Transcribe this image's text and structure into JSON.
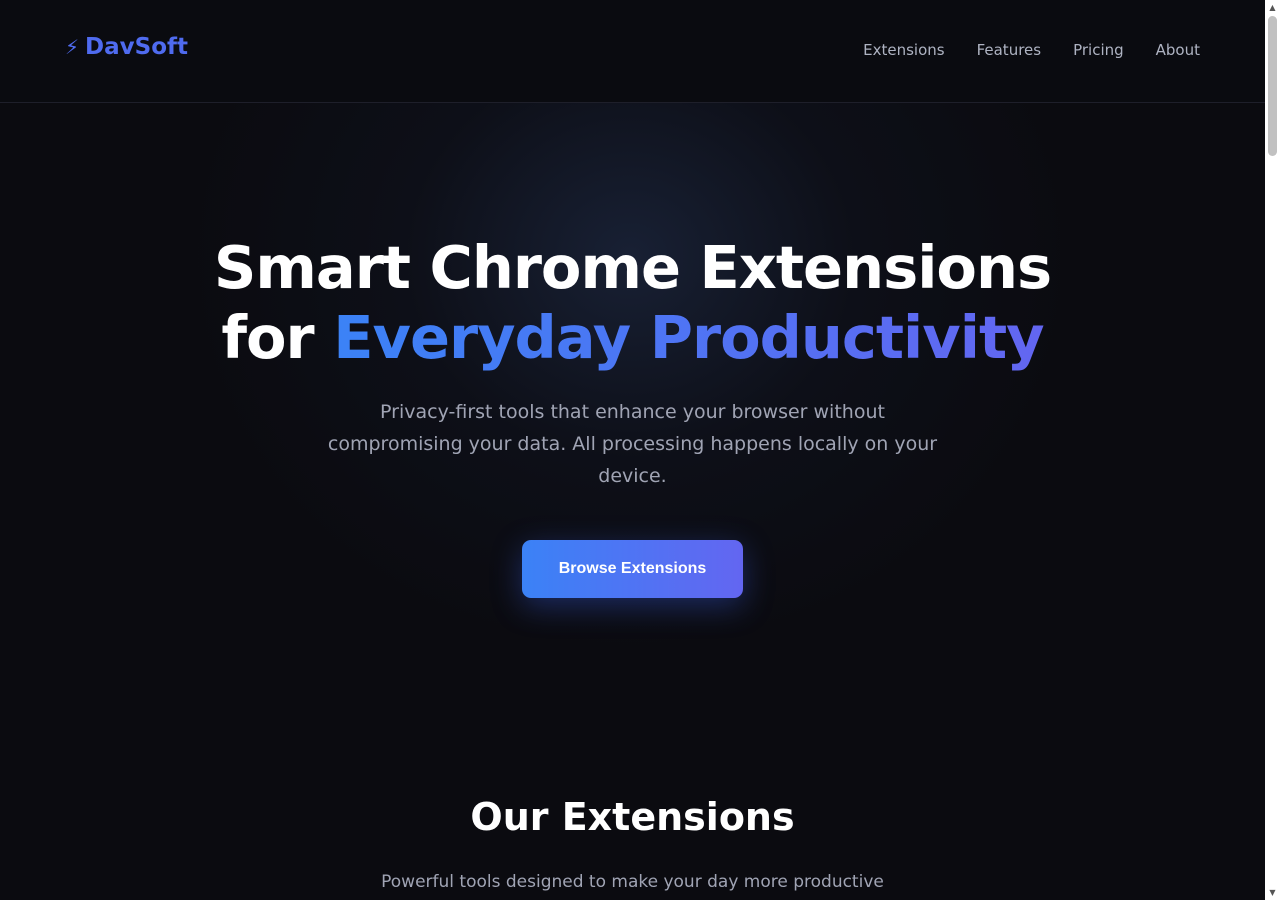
{
  "header": {
    "logo_icon": "lightning-bolt-icon",
    "logo_text": "DavSoft",
    "nav": [
      {
        "label": "Extensions"
      },
      {
        "label": "Features"
      },
      {
        "label": "Pricing"
      },
      {
        "label": "About"
      }
    ]
  },
  "hero": {
    "title_line1": "Smart Chrome Extensions",
    "title_line2_prefix": "for ",
    "title_line2_accent": "Everyday Productivity",
    "subtitle_lines": [
      "Privacy-first tools that enhance your browser without",
      "compromising your data. All processing happens locally on your",
      "device."
    ],
    "cta_label": "Browse Extensions"
  },
  "extensions_section": {
    "title": "Our Extensions",
    "subtitle": "Powerful tools designed to make your day more productive"
  },
  "colors": {
    "background": "#0b0b10",
    "brand": "#4f6bef",
    "accent_start": "#3b82f6",
    "accent_end": "#6366f1",
    "muted_text": "#a0a4b4"
  }
}
